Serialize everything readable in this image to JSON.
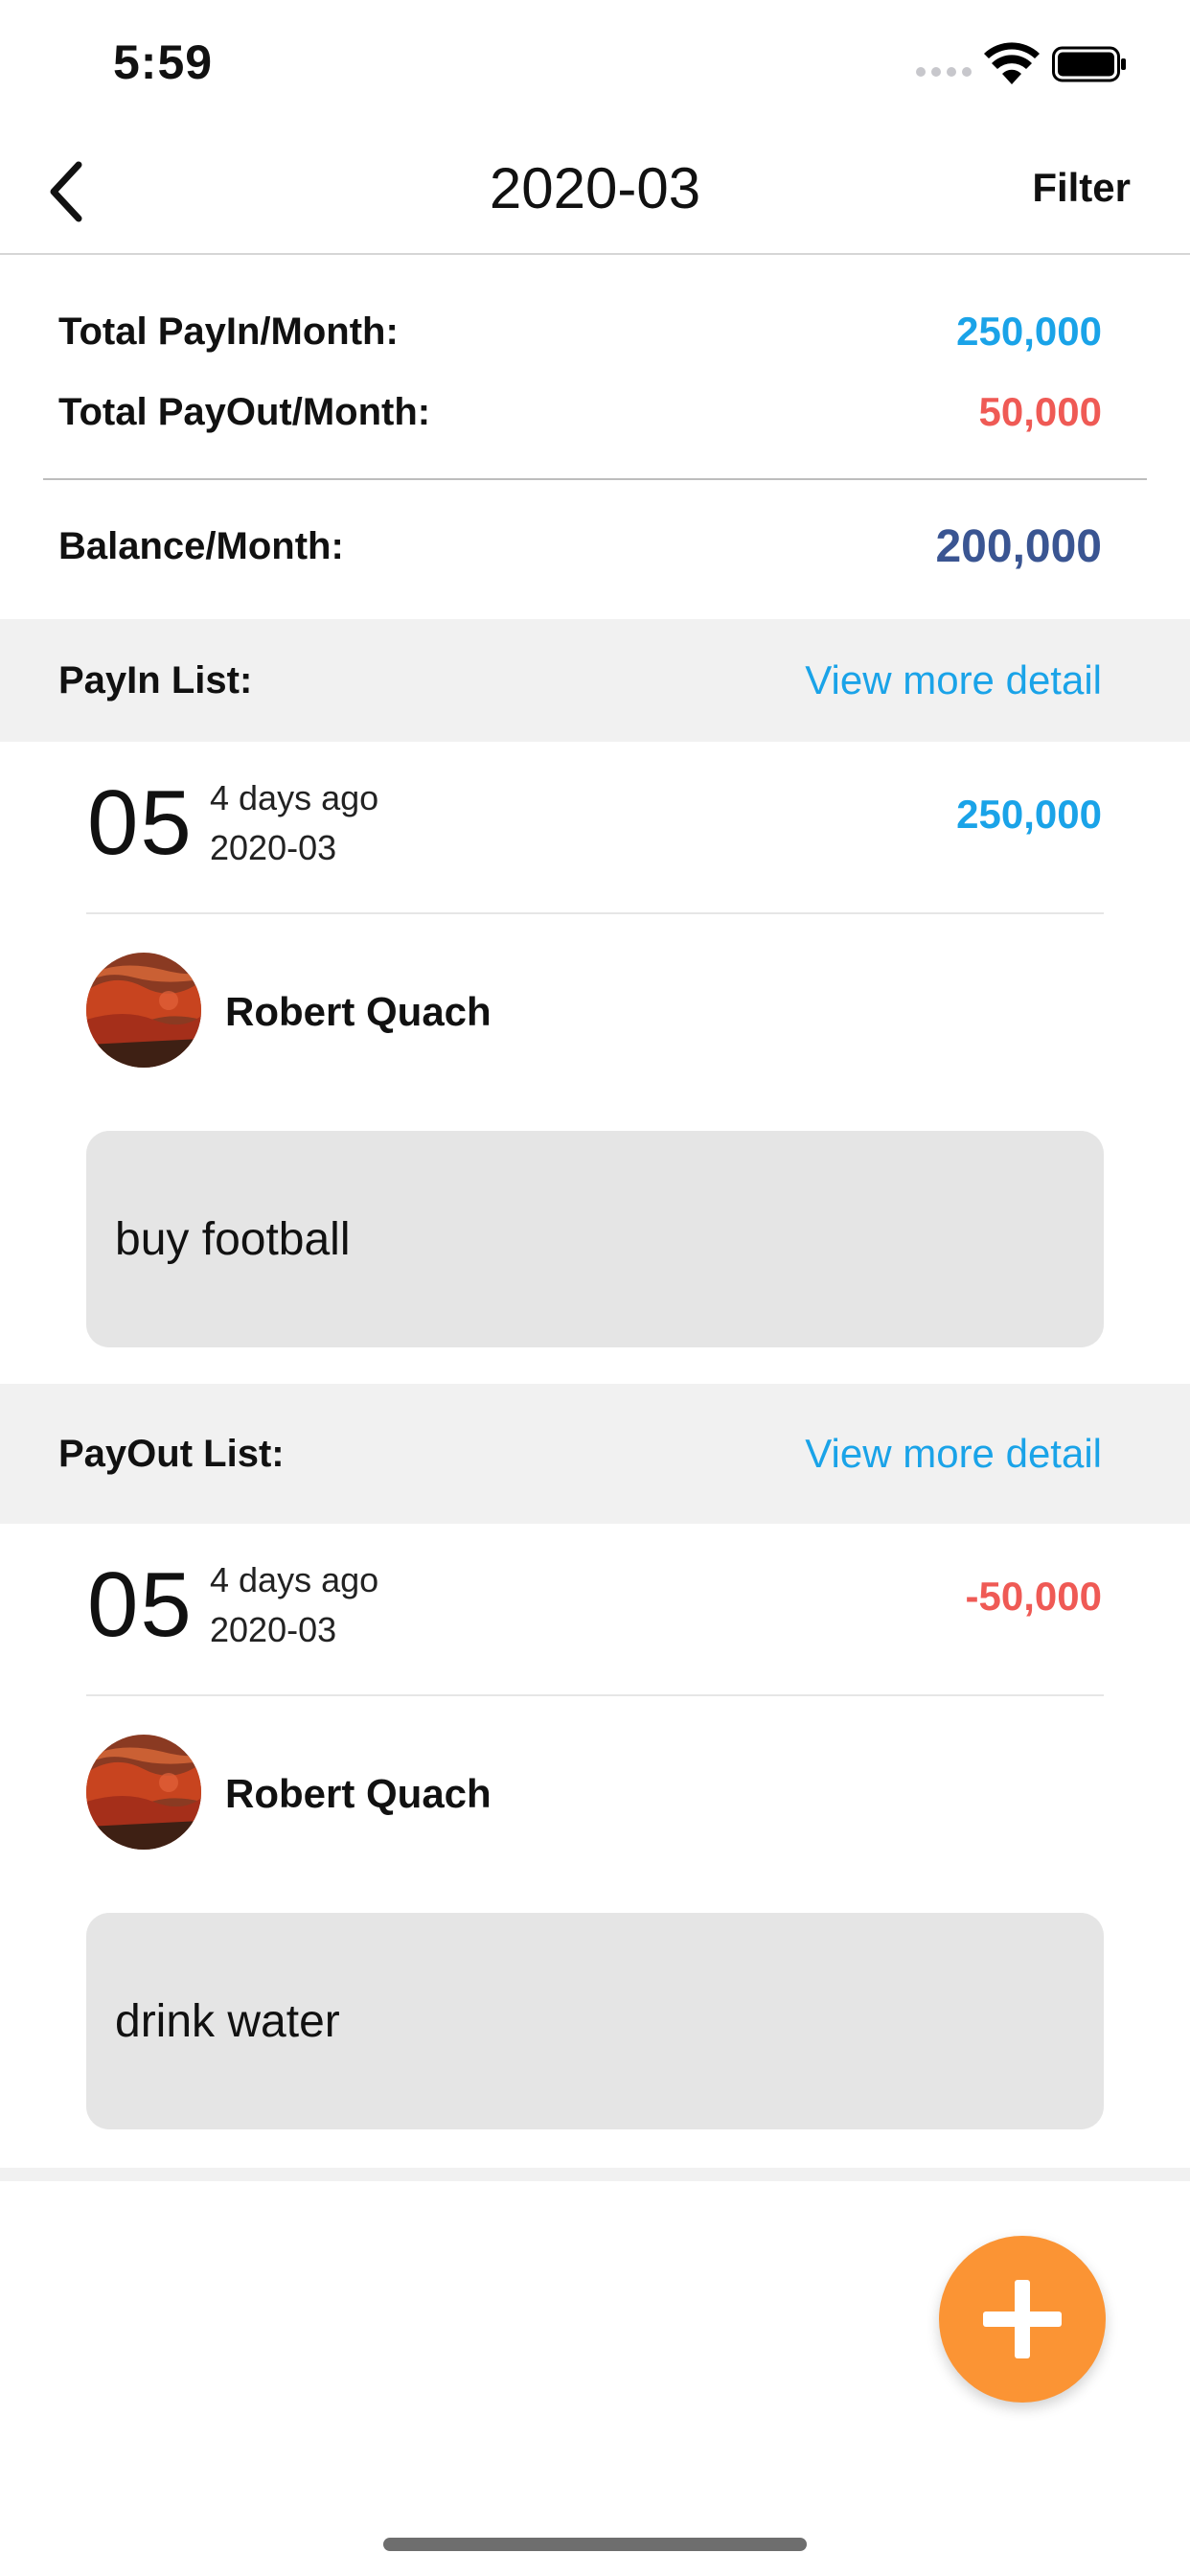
{
  "status_bar": {
    "time": "5:59"
  },
  "nav": {
    "title": "2020-03",
    "filter_label": "Filter"
  },
  "summary": {
    "payin_label": "Total PayIn/Month:",
    "payin_value": "250,000",
    "payout_label": "Total PayOut/Month:",
    "payout_value": "50,000",
    "balance_label": "Balance/Month:",
    "balance_value": "200,000"
  },
  "payin": {
    "title": "PayIn List:",
    "view_more": "View more detail",
    "entry": {
      "day": "05",
      "relative": "4 days ago",
      "date": "2020-03",
      "amount": "250,000",
      "name": "Robert Quach",
      "note": "buy football"
    }
  },
  "payout": {
    "title": "PayOut List:",
    "view_more": "View more detail",
    "entry": {
      "day": "05",
      "relative": "4 days ago",
      "date": "2020-03",
      "amount": "-50,000",
      "name": "Robert Quach",
      "note": "drink water"
    }
  },
  "colors": {
    "payin": "#1aa3e8",
    "payout": "#ef5a55",
    "balance": "#3a5592",
    "fab": "#fb9434"
  },
  "icons": {
    "back": "chevron-left-icon",
    "add": "plus-icon",
    "wifi": "wifi-icon",
    "battery": "battery-icon"
  }
}
